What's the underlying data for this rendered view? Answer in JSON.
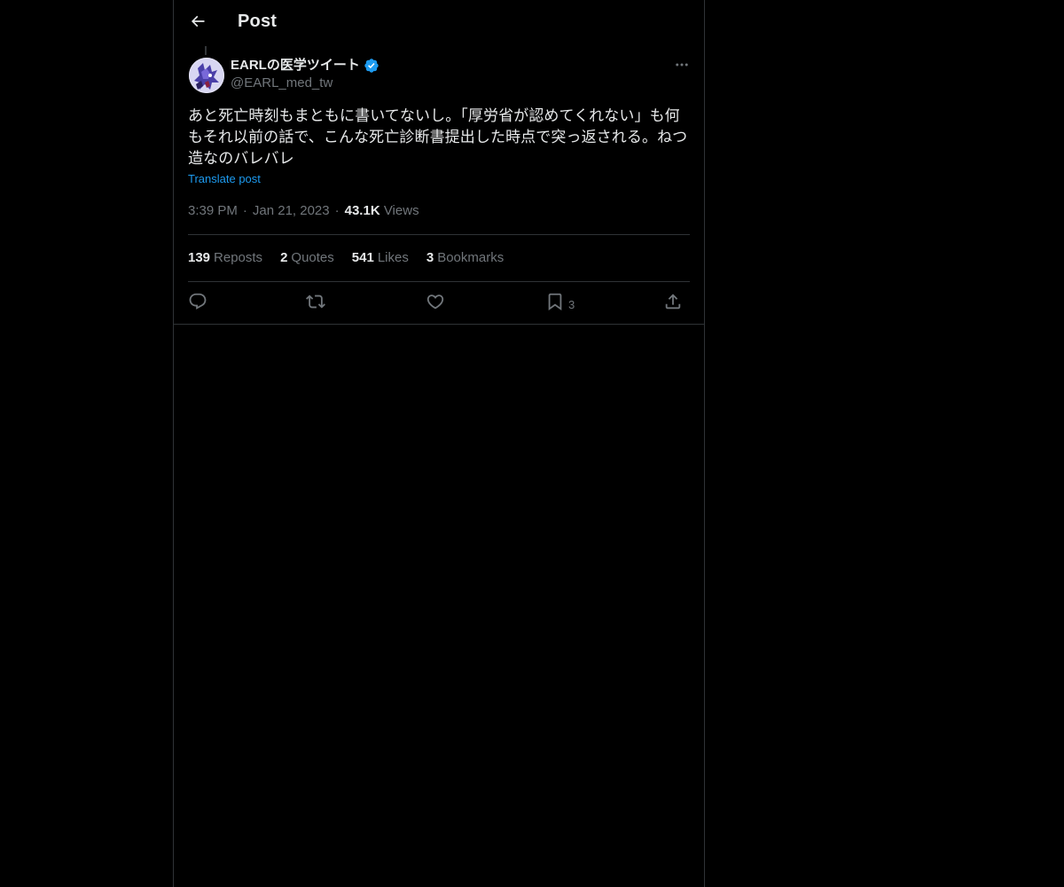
{
  "header": {
    "title": "Post",
    "back_icon": "arrow-left-icon"
  },
  "author": {
    "display_name": "EARLの医学ツイート",
    "handle": "@EARL_med_tw",
    "verified_icon": "verified-badge-icon",
    "avatar_icon": "avatar-illustration"
  },
  "more_icon": "more-options-icon",
  "tweet": {
    "text": "あと死亡時刻もまともに書いてないし。「厚労省が認めてくれない」も何もそれ以前の話で、こんな死亡診断書提出した時点で突っ返される。ねつ造なのバレバレ",
    "translate_label": "Translate post",
    "time": "3:39 PM",
    "date": "Jan 21, 2023",
    "views_count": "43.1K",
    "views_label": "Views",
    "separator": "·"
  },
  "stats": {
    "reposts_count": "139",
    "reposts_label": "Reposts",
    "quotes_count": "2",
    "quotes_label": "Quotes",
    "likes_count": "541",
    "likes_label": "Likes",
    "bookmarks_count": "3",
    "bookmarks_label": "Bookmarks"
  },
  "actions": {
    "reply_icon": "reply-icon",
    "repost_icon": "repost-icon",
    "like_icon": "heart-icon",
    "bookmark_icon": "bookmark-icon",
    "bookmark_count": "3",
    "share_icon": "share-icon"
  },
  "colors": {
    "background": "#000000",
    "text": "#e7e9ea",
    "muted": "#71767b",
    "link": "#1d9bf0",
    "border": "#2f3336"
  }
}
